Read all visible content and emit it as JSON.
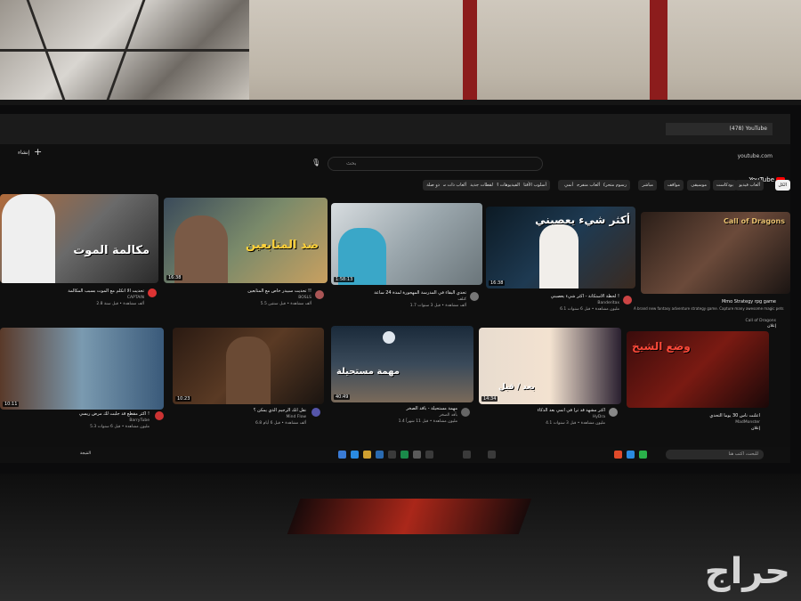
{
  "browser": {
    "tab_title": "(478) YouTube",
    "address": "youtube.com"
  },
  "youtube": {
    "logo": "YouTube",
    "search_placeholder": "بحث",
    "create_label": "إنشاء",
    "chips": [
      {
        "label": "الكل",
        "active": true
      },
      {
        "label": "ألعاب فيديو"
      },
      {
        "label": "بودكاست"
      },
      {
        "label": "موسيقى"
      },
      {
        "label": "مواقف"
      },
      {
        "label": "مباشر"
      },
      {
        "label": "رسوم متحركة"
      },
      {
        "label": "ألعاب منفرجة بصرية"
      },
      {
        "label": "أنمي"
      },
      {
        "label": "أسلوب الأقتال"
      },
      {
        "label": "الفيديوهات التي شاهدتها"
      },
      {
        "label": "لقطات جديدة"
      },
      {
        "label": "ألعاب ذات سباقيات"
      },
      {
        "label": "ذو صلة"
      }
    ],
    "videos_row1": [
      {
        "title": "لحظة الاستكانة - أكثر شيء يعصبني !",
        "channel": "Banderitax",
        "meta": "6.1 مليون مشاهدة • قبل 6 سنوات",
        "duration": "16:38",
        "overlay": "أكثر شيء يعصبني"
      },
      {
        "title": "تحدي البقاء في المدرسة المهجورة لمدة 24 ساعة",
        "channel": "كتلف",
        "meta": "1.7 ألف مشاهدة • قبل 3 سنوات",
        "duration": "1:58:13",
        "overlay": ""
      },
      {
        "title": "تحديت سبيدر خاص مع المتابعين !!",
        "channel": "BOSLS",
        "meta": "5.5 ألف مشاهدة • قبل سنتين",
        "duration": "16:38",
        "overlay": "ضد المتابعين"
      },
      {
        "title": "تحديت الا أتكلم مع الموت بسبب المكالمة",
        "channel": "CAPTAIN",
        "meta": "2.8 ألف مشاهدة • قبل سنة",
        "duration": "",
        "overlay": "مكالمة الموت"
      }
    ],
    "ad_row1": {
      "title": "Mmo Strategy rpg game",
      "desc": "A brand new fantasy adventure strategy game. Capture many awesome magic pets",
      "advertiser": "Call of Dragons",
      "sponsored": "إعلان"
    },
    "videos_row2": [
      {
        "title": "أعلنت ناس 30 يوماً التحدي",
        "channel": "MadMonster",
        "meta": "إعلان",
        "duration": "",
        "overlay": "وضع الشيخ"
      },
      {
        "title": "أكثر مشهد قد ترا في أنمي بعد الذكاء",
        "channel": "HyDra",
        "meta": "4.1 مليون مشاهدة • قبل 3 سنوات",
        "duration": "14:34",
        "overlay": "بعد / قبل"
      },
      {
        "title": "مهمة مستحيلة - بأقد الصخر",
        "channel": "بأقد الصخر",
        "meta": "1.4 مليون مشاهدة • قبل 11 شهراً",
        "duration": "40:49",
        "overlay": "مهمة مستحيلة"
      },
      {
        "title": "نقل أنك الرجيم الذي يمكن ؟",
        "channel": "Mind Flow",
        "meta": "6.8 ألف مشاهدة • قبل 6 أيام",
        "duration": "10:23",
        "overlay": ""
      },
      {
        "title": "أكثر مقطع قد جلبت لك مرض ريسي !",
        "channel": "BarryTube",
        "meta": "5.3 مليون مشاهدة • قبل 6 سنوات",
        "duration": "10:11",
        "overlay": ""
      }
    ]
  },
  "taskbar": {
    "search_placeholder": "للبحث، اكتب هنا",
    "weather": "النتيجة"
  },
  "watermark": "حراج",
  "colors": {
    "yt_red": "#ff0000",
    "wall": "#c5bdb0",
    "pillar": "#8c1c1c",
    "stand_red": "#c42a1a"
  }
}
